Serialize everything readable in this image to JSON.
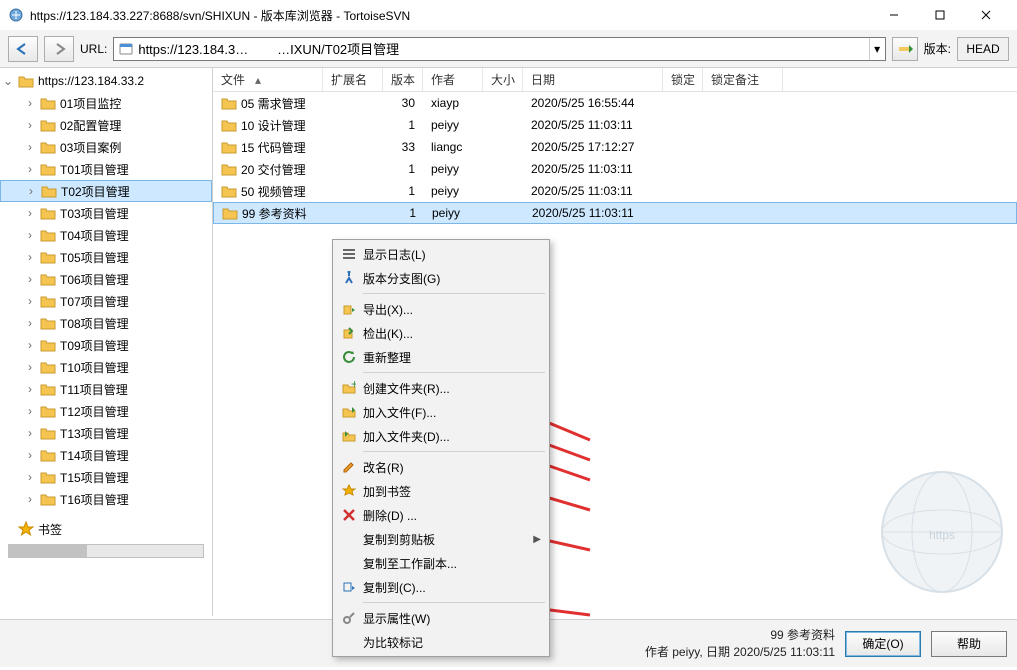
{
  "window": {
    "title": "https://123.184.33.227:8688/svn/SHIXUN - 版本库浏览器 - TortoiseSVN"
  },
  "toolbar": {
    "url_label": "URL:",
    "url_value": "https://123.184.3…        …IXUN/T02项目管理",
    "rev_label": "版本:",
    "rev_value": "HEAD"
  },
  "tree": {
    "root": "https://123.184.33.2",
    "items": [
      "01项目监控",
      "02配置管理",
      "03项目案例",
      "T01项目管理",
      "T02项目管理",
      "T03项目管理",
      "T04项目管理",
      "T05项目管理",
      "T06项目管理",
      "T07项目管理",
      "T08项目管理",
      "T09项目管理",
      "T10项目管理",
      "T11项目管理",
      "T12项目管理",
      "T13项目管理",
      "T14项目管理",
      "T15项目管理",
      "T16项目管理"
    ],
    "selected_index": 4,
    "bookmark_label": "书签"
  },
  "list": {
    "cols": {
      "file": "文件",
      "ext": "扩展名",
      "rev": "版本",
      "auth": "作者",
      "size": "大小",
      "date": "日期",
      "lock": "锁定",
      "note": "锁定备注"
    },
    "rows": [
      {
        "file": "05 需求管理",
        "rev": "30",
        "auth": "xiayp",
        "date": "2020/5/25 16:55:44"
      },
      {
        "file": "10 设计管理",
        "rev": "1",
        "auth": "peiyy",
        "date": "2020/5/25 11:03:11"
      },
      {
        "file": "15 代码管理",
        "rev": "33",
        "auth": "liangc",
        "date": "2020/5/25 17:12:27"
      },
      {
        "file": "20 交付管理",
        "rev": "1",
        "auth": "peiyy",
        "date": "2020/5/25 11:03:11"
      },
      {
        "file": "50 视频管理",
        "rev": "1",
        "auth": "peiyy",
        "date": "2020/5/25 11:03:11"
      },
      {
        "file": "99 参考资料",
        "rev": "1",
        "auth": "peiyy",
        "date": "2020/5/25 11:03:11"
      }
    ],
    "selected_index": 5
  },
  "context_menu": {
    "items": [
      {
        "icon": "log",
        "label": "显示日志(L)"
      },
      {
        "icon": "graph",
        "label": "版本分支图(G)"
      },
      {
        "sep": true
      },
      {
        "icon": "export",
        "label": "导出(X)..."
      },
      {
        "icon": "checkout",
        "label": "检出(K)..."
      },
      {
        "icon": "refresh",
        "label": "重新整理"
      },
      {
        "sep": true
      },
      {
        "icon": "newfolder",
        "label": "创建文件夹(R)...",
        "arrow": true
      },
      {
        "icon": "addfile",
        "label": "加入文件(F)...",
        "arrow": true
      },
      {
        "icon": "addfolder",
        "label": "加入文件夹(D)...",
        "arrow": true
      },
      {
        "sep": true
      },
      {
        "icon": "rename",
        "label": "改名(R)",
        "arrow": true
      },
      {
        "icon": "bookmark",
        "label": "加到书签"
      },
      {
        "icon": "delete",
        "label": "删除(D) ...",
        "arrow": true
      },
      {
        "icon": "",
        "label": "复制到剪贴板",
        "sub": true
      },
      {
        "icon": "",
        "label": "复制至工作副本..."
      },
      {
        "icon": "copyto",
        "label": "复制到(C)...",
        "arrow": true
      },
      {
        "sep": true
      },
      {
        "icon": "props",
        "label": "显示属性(W)"
      },
      {
        "icon": "",
        "label": "为比较标记"
      }
    ]
  },
  "status": {
    "line1": "99 参考资料",
    "line2": "作者 peiyy, 日期 2020/5/25 11:03:11",
    "ok": "确定(O)",
    "help": "帮助"
  }
}
